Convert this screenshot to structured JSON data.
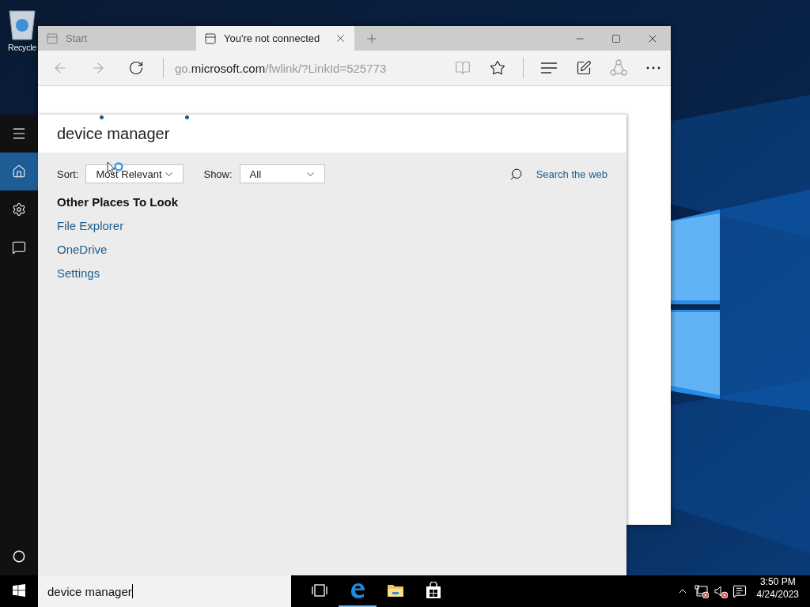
{
  "desktop": {
    "icons": [
      {
        "label": "Recycle"
      }
    ]
  },
  "browser": {
    "tabs": [
      {
        "title": "Start",
        "selected": false
      },
      {
        "title": "You're not connected",
        "selected": true
      }
    ],
    "toolbar": [
      {
        "kind": "back",
        "disabled": true
      },
      {
        "kind": "forward",
        "disabled": true
      },
      {
        "kind": "refresh",
        "disabled": false
      }
    ],
    "address": {
      "prefix": "go.",
      "host": "microsoft.com",
      "path": "/fwlink/?LinkId=525773"
    },
    "actions": [
      {
        "kind": "reading",
        "disabled": true
      },
      {
        "kind": "favorite",
        "disabled": false
      },
      {
        "kind": "divider"
      },
      {
        "kind": "hub",
        "disabled": false
      },
      {
        "kind": "note",
        "disabled": false
      },
      {
        "kind": "share",
        "disabled": true
      },
      {
        "kind": "more",
        "disabled": false
      }
    ]
  },
  "start_rail": {
    "items": [
      {
        "kind": "menu",
        "selected": false
      },
      {
        "kind": "home",
        "selected": true
      },
      {
        "kind": "settings",
        "selected": false
      },
      {
        "kind": "feedback",
        "selected": false
      }
    ],
    "bottom": [
      {
        "kind": "cortana",
        "selected": false
      }
    ]
  },
  "search_panel": {
    "query": "device manager",
    "sort": {
      "label": "Sort:",
      "value": "Most Relevant"
    },
    "show": {
      "label": "Show:",
      "value": "All"
    },
    "web_link": "Search the web",
    "section": {
      "title": "Other Places To Look",
      "links": [
        "File Explorer",
        "OneDrive",
        "Settings"
      ]
    }
  },
  "taskbar": {
    "search_text": "device manager",
    "apps": [
      {
        "kind": "taskview",
        "running": false
      },
      {
        "kind": "edge",
        "running": true
      },
      {
        "kind": "explorer",
        "running": false
      },
      {
        "kind": "store",
        "running": false
      }
    ],
    "tray": [
      {
        "kind": "chevron"
      },
      {
        "kind": "network"
      },
      {
        "kind": "volume"
      },
      {
        "kind": "action"
      }
    ],
    "time": "3:50 PM",
    "date": "4/24/2023"
  }
}
